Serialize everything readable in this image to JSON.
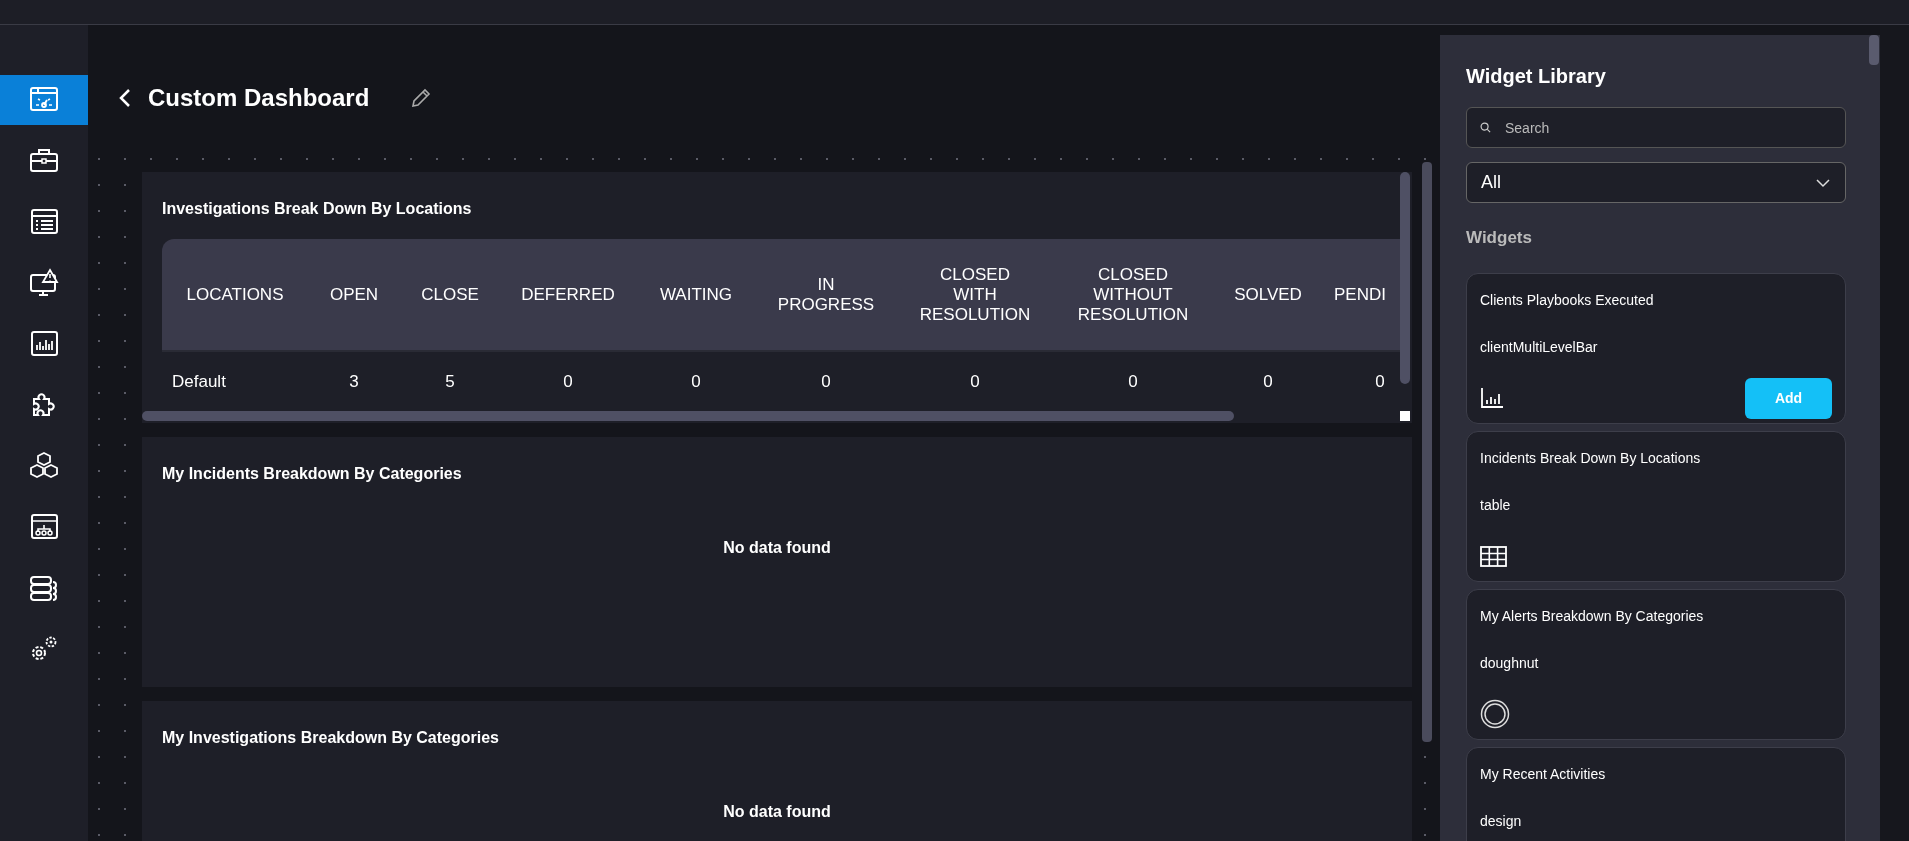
{
  "sidebar": {
    "items": [
      {
        "selected": true
      },
      {
        "selected": false
      },
      {
        "selected": false
      },
      {
        "selected": false
      },
      {
        "selected": false
      },
      {
        "selected": false
      },
      {
        "selected": false
      },
      {
        "selected": false
      },
      {
        "selected": false
      },
      {
        "selected": false
      }
    ]
  },
  "header": {
    "title": "Custom Dashboard"
  },
  "widgets": [
    {
      "kind": "table",
      "title": "Investigations Break Down By Locations",
      "table": {
        "columns": [
          "LOCATIONS",
          "OPEN",
          "CLOSE",
          "DEFERRED",
          "WAITING",
          "IN PROGRESS",
          "CLOSED WITH RESOLUTION",
          "CLOSED WITHOUT RESOLUTION",
          "SOLVED",
          "PENDI"
        ],
        "rows": [
          [
            "Default",
            "3",
            "5",
            "0",
            "0",
            "0",
            "0",
            "0",
            "0",
            "0"
          ]
        ]
      }
    },
    {
      "kind": "empty",
      "title": "My Incidents Breakdown By Categories",
      "message": "No data found"
    },
    {
      "kind": "empty",
      "title": "My Investigations Breakdown By Categories",
      "message": "No data found"
    }
  ],
  "library": {
    "title": "Widget Library",
    "search": {
      "placeholder": "Search"
    },
    "filter": {
      "value": "All"
    },
    "section": "Widgets",
    "cards": [
      {
        "kind": "bar",
        "title": "Clients Playbooks Executed",
        "type": "clientMultiLevelBar",
        "button": "Add"
      },
      {
        "kind": "table",
        "title": "Incidents Break Down By Locations",
        "type": "table"
      },
      {
        "kind": "doughnut",
        "title": "My Alerts Breakdown By Categories",
        "type": "doughnut"
      },
      {
        "kind": "design",
        "title": "My Recent Activities",
        "type": "design"
      }
    ]
  }
}
